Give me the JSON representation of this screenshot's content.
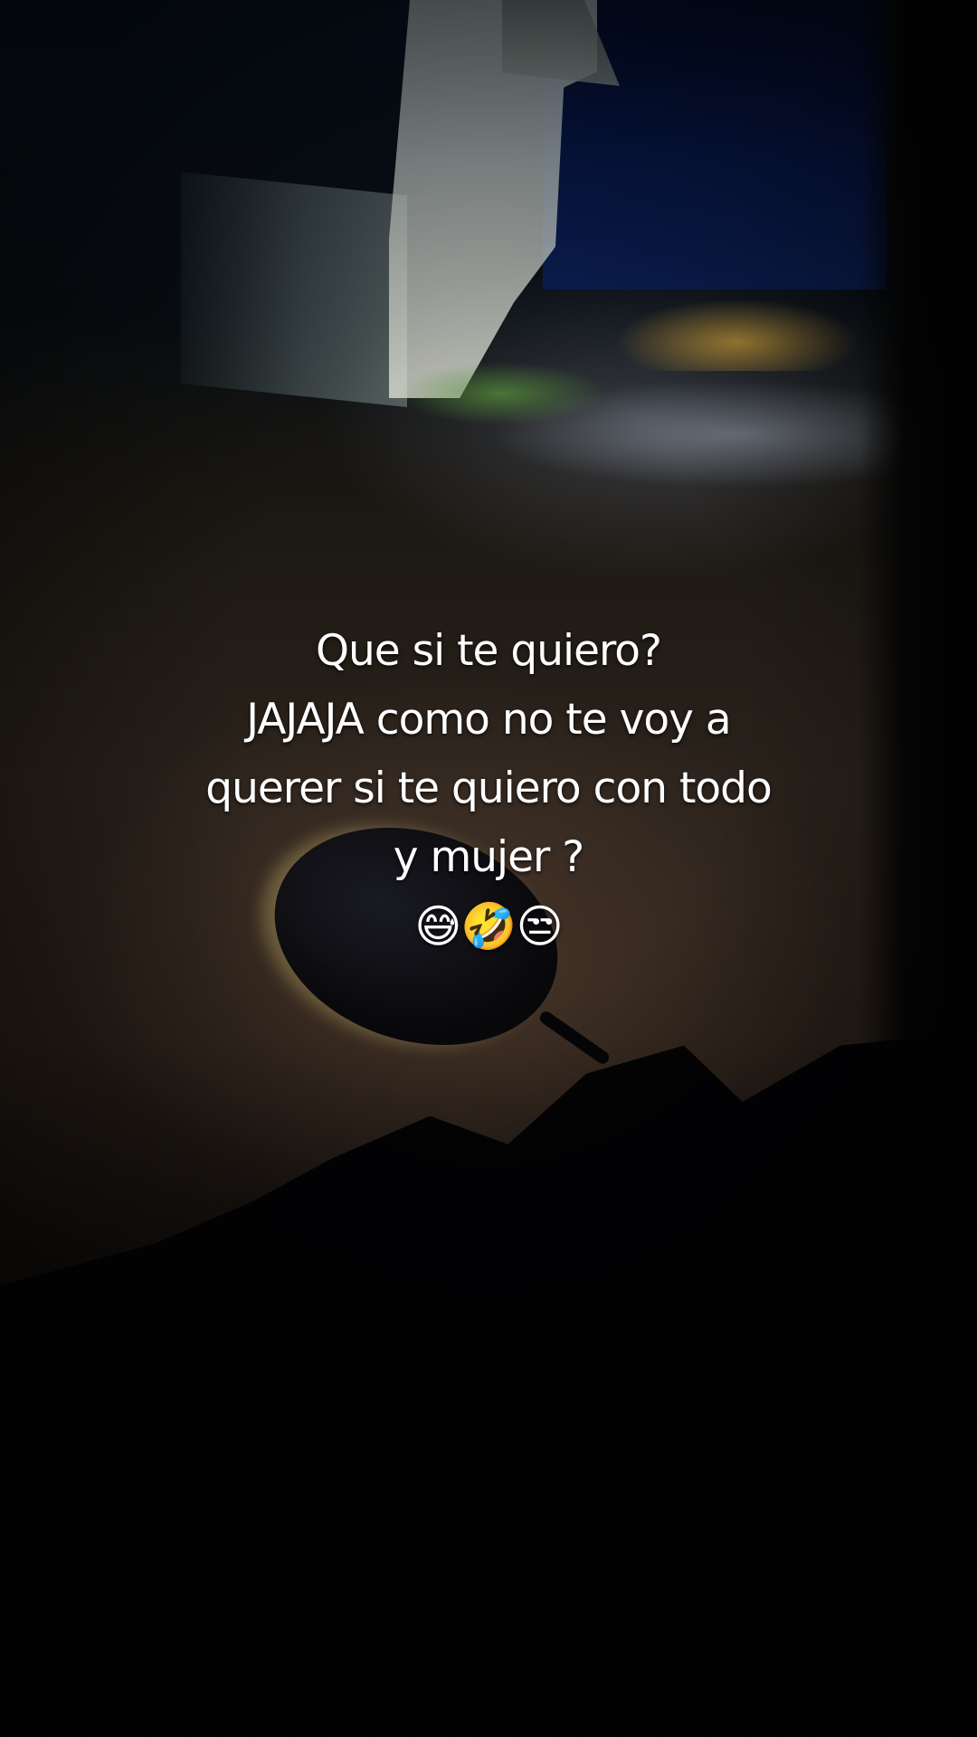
{
  "caption": {
    "line1": "Que si te quiero?",
    "line2": "JAJAJA como no te voy a",
    "line3": "querer si te quiero con todo",
    "line4": "y mujer ?",
    "line5": "😅🤣😒"
  }
}
